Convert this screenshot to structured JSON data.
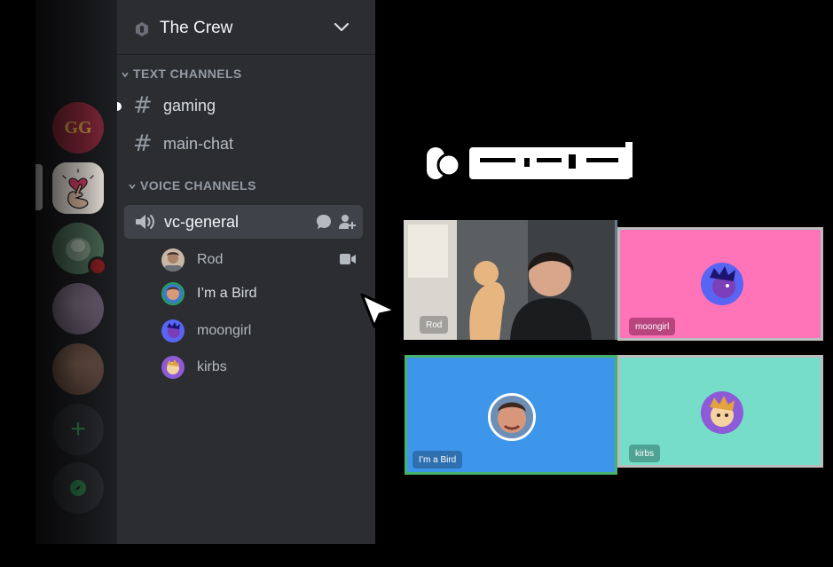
{
  "server": {
    "name": "The Crew"
  },
  "categories": {
    "text": "TEXT CHANNELS",
    "voice": "VOICE CHANNELS"
  },
  "text_channels": [
    {
      "label": "gaming",
      "unread": true
    },
    {
      "label": "main-chat",
      "unread": false
    }
  ],
  "voice_channel": {
    "label": "vc-general",
    "members": [
      {
        "name": "Rod",
        "video": true
      },
      {
        "name": "I’m a Bird",
        "speaking": true
      },
      {
        "name": "moongirl"
      },
      {
        "name": "kirbs"
      }
    ]
  },
  "server_rail": {
    "items": [
      "gg-server",
      "heart-server",
      "green-server",
      "purple-server",
      "brown-server",
      "add-server",
      "explore-servers"
    ],
    "gg_text": "GG"
  },
  "tiles": [
    {
      "name": "Rod",
      "color": "#3a3d3f"
    },
    {
      "name": "moongirl",
      "color": "#ff73b8"
    },
    {
      "name": "I’m a Bird",
      "color": "#3d96ea",
      "speaking_border": "#47b26b"
    },
    {
      "name": "kirbs",
      "color": "#75ddc8"
    }
  ],
  "icons": {
    "server": "server-icon",
    "chevron": "chevron-down-icon",
    "hash": "#",
    "speaker": "speaker-icon",
    "chat": "chat-bubble-icon",
    "invite": "add-user-icon",
    "camera": "camera-icon",
    "cursor": "cursor-pointer-icon"
  },
  "colors": {
    "rail": "#1e1f22",
    "sidebar": "#2b2d31",
    "selected": "#404249",
    "accent_green": "#23a55a"
  }
}
